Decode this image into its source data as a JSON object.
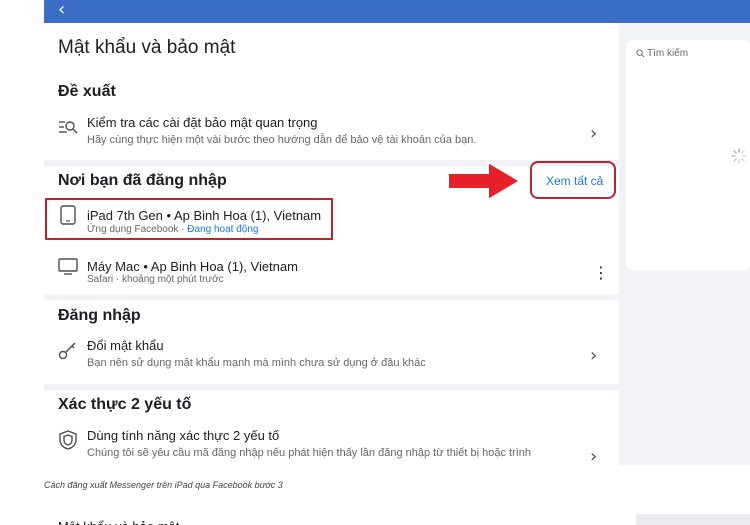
{
  "header": {
    "back_icon": "chevron-left-icon"
  },
  "page": {
    "title": "Mật khẩu và bảo mật"
  },
  "suggest": {
    "heading": "Đề xuất",
    "item_title": "Kiểm tra các cài đặt bảo mật quan trọng",
    "item_sub": "Hãy cùng thực hiện một vài bước theo hướng dẫn để bảo vệ tài khoản của bạn."
  },
  "logged_in": {
    "heading": "Nơi bạn đã đăng nhập",
    "see_all": "Xem tất cả",
    "devices": [
      {
        "name": "iPad 7th Gen • Ap Binh Hoa (1), Vietnam",
        "app": "Ứng dụng Facebook · ",
        "status": "Đang hoạt động"
      },
      {
        "name": "Máy Mac • Ap Binh Hoa (1), Vietnam",
        "app": "Safari · khoảng một phút trước",
        "status": ""
      }
    ]
  },
  "login": {
    "heading": "Đăng nhập",
    "item_title": "Đổi mật khẩu",
    "item_sub": "Bạn nên sử dụng mật khẩu mạnh mà mình chưa sử dụng ở đâu khác"
  },
  "twofa": {
    "heading": "Xác thực 2 yếu tố",
    "item_title": "Dùng tính năng xác thực 2 yếu tố",
    "item_sub": "Chúng tôi sẽ yêu cầu mã đăng nhập nếu phát hiện thấy lần đăng nhập từ thiết bị hoặc trình"
  },
  "sidebar": {
    "search_placeholder": "Tìm kiếm"
  },
  "caption": "Cách đăng xuất Messenger trên iPad qua Facebook bước 3",
  "next_heading": "Mật khẩu và bảo mật",
  "colors": {
    "accent": "#1877f2",
    "header": "#3b6cc6",
    "highlight": "#c0212a"
  }
}
